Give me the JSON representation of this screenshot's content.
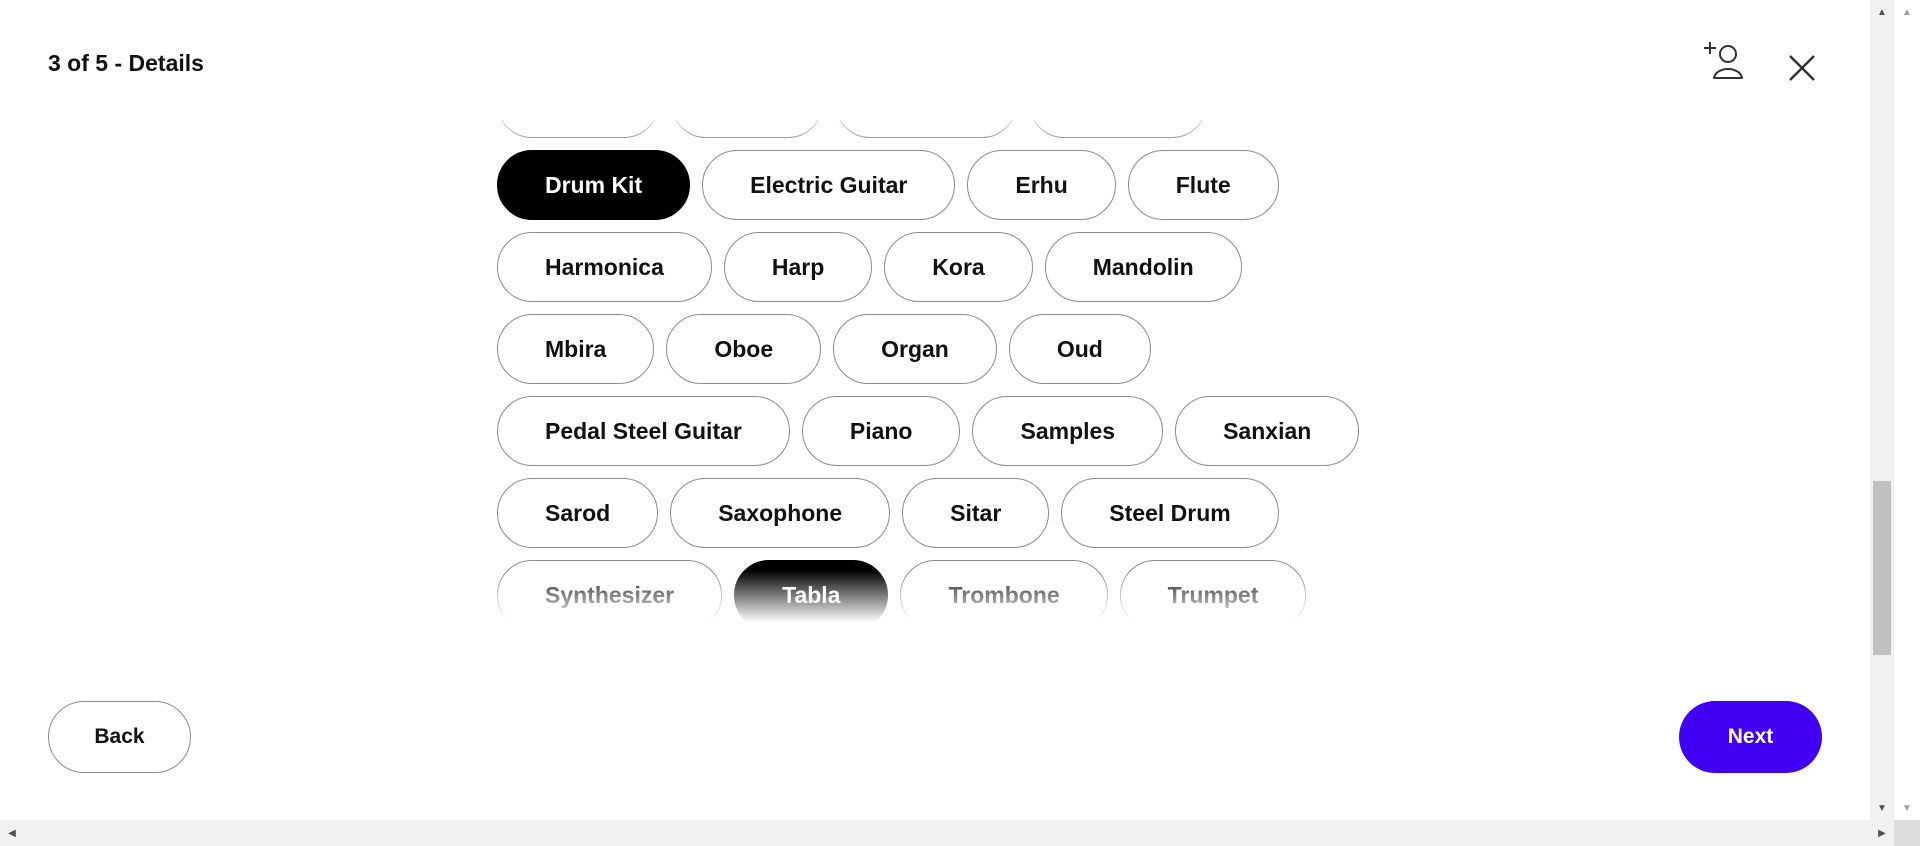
{
  "header": {
    "title": "3 of 5 - Details",
    "add_person_icon": "add-person-icon",
    "close_icon": "close-icon"
  },
  "instruments": {
    "rows": [
      [
        {
          "label": "",
          "selected": false
        },
        {
          "label": "",
          "selected": false
        },
        {
          "label": "",
          "selected": false
        },
        {
          "label": "",
          "selected": false
        }
      ],
      [
        {
          "label": "Drum Kit",
          "selected": true
        },
        {
          "label": "Electric Guitar",
          "selected": false
        },
        {
          "label": "Erhu",
          "selected": false
        },
        {
          "label": "Flute",
          "selected": false
        }
      ],
      [
        {
          "label": "Harmonica",
          "selected": false
        },
        {
          "label": "Harp",
          "selected": false
        },
        {
          "label": "Kora",
          "selected": false
        },
        {
          "label": "Mandolin",
          "selected": false
        }
      ],
      [
        {
          "label": "Mbira",
          "selected": false
        },
        {
          "label": "Oboe",
          "selected": false
        },
        {
          "label": "Organ",
          "selected": false
        },
        {
          "label": "Oud",
          "selected": false
        }
      ],
      [
        {
          "label": "Pedal Steel Guitar",
          "selected": false
        },
        {
          "label": "Piano",
          "selected": false
        },
        {
          "label": "Samples",
          "selected": false
        },
        {
          "label": "Sanxian",
          "selected": false
        }
      ],
      [
        {
          "label": "Sarod",
          "selected": false
        },
        {
          "label": "Saxophone",
          "selected": false
        },
        {
          "label": "Sitar",
          "selected": false
        },
        {
          "label": "Steel Drum",
          "selected": false
        }
      ],
      [
        {
          "label": "Synthesizer",
          "selected": false
        },
        {
          "label": "Tabla",
          "selected": true
        },
        {
          "label": "Trombone",
          "selected": false
        },
        {
          "label": "Trumpet",
          "selected": false
        }
      ]
    ]
  },
  "footer": {
    "back_label": "Back",
    "next_label": "Next"
  },
  "colors": {
    "accent": "#4100f4",
    "selected_chip": "#000000",
    "chip_border": "#8d8d8d"
  },
  "scrollbar": {
    "vertical_position_fraction": 0.68
  }
}
